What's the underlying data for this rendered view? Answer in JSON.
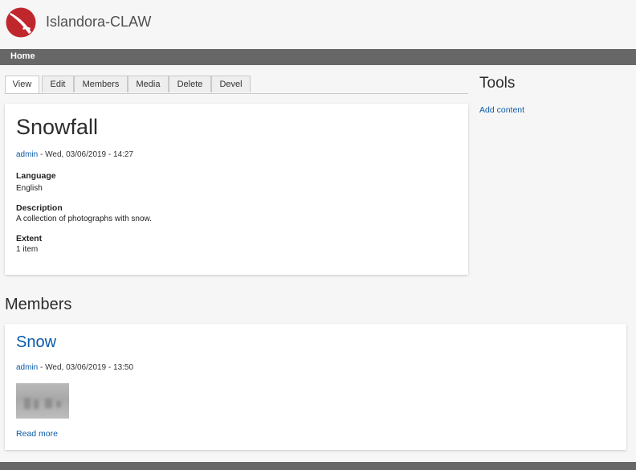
{
  "site": {
    "name": "Islandora-CLAW",
    "logo_icon": "claw-logo-icon",
    "brand_color": "#c0272d"
  },
  "nav": {
    "home_label": "Home"
  },
  "tabs": [
    {
      "label": "View",
      "active": true
    },
    {
      "label": "Edit",
      "active": false
    },
    {
      "label": "Members",
      "active": false
    },
    {
      "label": "Media",
      "active": false
    },
    {
      "label": "Delete",
      "active": false
    },
    {
      "label": "Devel",
      "active": false
    }
  ],
  "node": {
    "title": "Snowfall",
    "author": "admin",
    "date": " - Wed, 03/06/2019 - 14:27",
    "fields": [
      {
        "label": "Language",
        "value": "English"
      },
      {
        "label": "Description",
        "value": "A collection of photographs with snow."
      },
      {
        "label": "Extent",
        "value": "1 item"
      }
    ]
  },
  "sidebar": {
    "title": "Tools",
    "link": "Add content"
  },
  "members": {
    "heading": "Members",
    "items": [
      {
        "title": "Snow",
        "author": "admin",
        "date": " - Wed, 03/06/2019 - 13:50",
        "read_more": "Read more"
      }
    ]
  },
  "colors": {
    "link": "#0b5aa8",
    "nav_bar": "#676767",
    "background": "#f6f6f6"
  }
}
